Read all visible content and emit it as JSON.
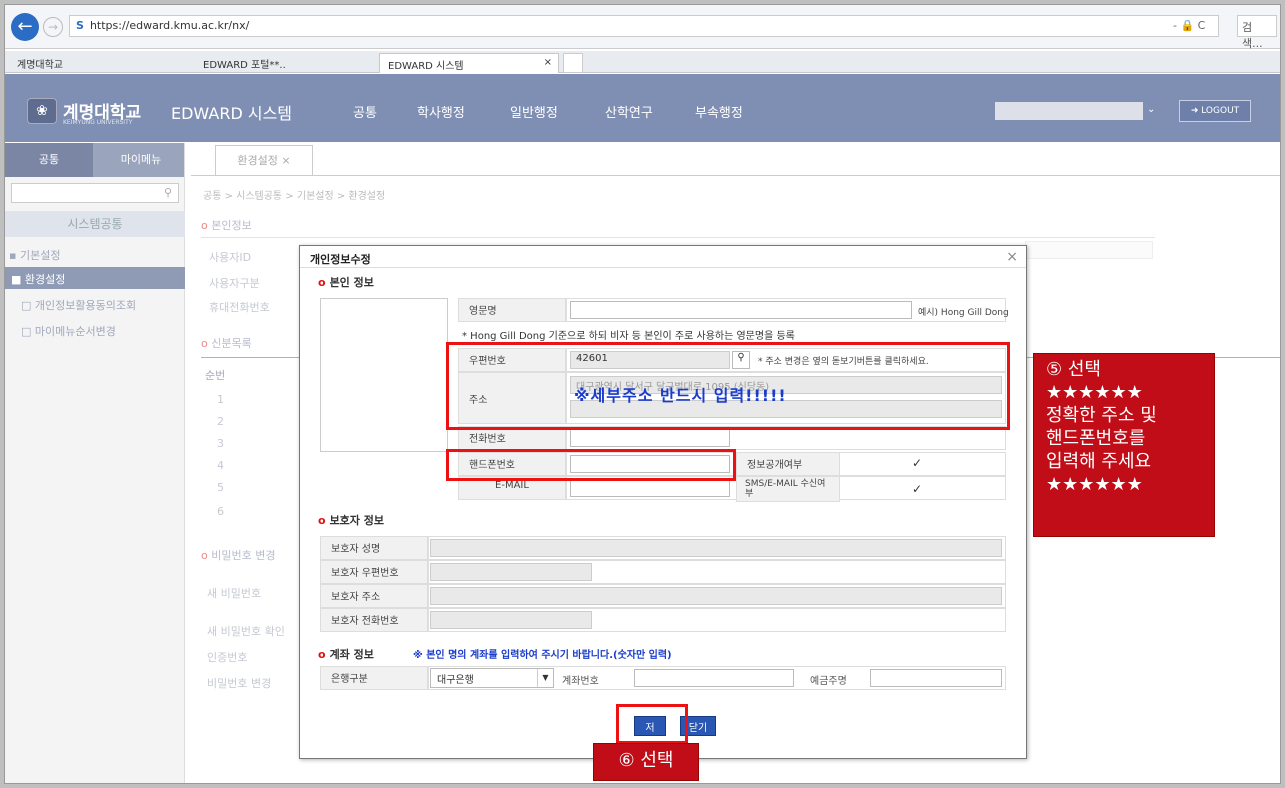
{
  "browser": {
    "url": "https://edward.kmu.ac.kr/nx/",
    "addr_right": "- 🔒 C",
    "search_placeholder": "검색...",
    "tabs": [
      "계명대학교",
      "EDWARD 포털**..",
      "EDWARD 시스템"
    ],
    "tab_close": "×"
  },
  "nav": {
    "logo_text": "계명대학교",
    "logo_sub": "KEIMYUNG UNIVERSITY",
    "system_title": "EDWARD 시스템",
    "menus": [
      "공통",
      "학사행정",
      "일반행정",
      "산학연구",
      "부속행정"
    ],
    "logout": "LOGOUT"
  },
  "sidebar": {
    "tabs": [
      "공통",
      "마이메뉴"
    ],
    "header": "시스템공통",
    "items": [
      "기본설정",
      "환경설정",
      "개인정보활용동의조회",
      "마이메뉴순서변경"
    ]
  },
  "content": {
    "tab": "환경설정",
    "breadcrumb": "공통 > 시스템공통 > 기본설정 > 환경설정",
    "bg_sections": [
      "본인정보",
      "신분목록",
      "비밀번호 변경"
    ],
    "bg_labels": [
      "사용자ID",
      "사용자구분",
      "휴대전화번호"
    ],
    "bg_col": "순번",
    "bg_rows": [
      "1",
      "2",
      "3",
      "4",
      "5",
      "6"
    ],
    "bg_pw_labels": [
      "새 비밀번호",
      "새 비밀번호 확인",
      "인증번호",
      "비밀번호 변경"
    ]
  },
  "dialog": {
    "title": "개인정보수정",
    "close": "×",
    "personal_section": "본인 정보",
    "labels": {
      "eng_name": "영문명",
      "zip": "우편번호",
      "address": "주소",
      "phone": "전화번호",
      "mobile": "핸드폰번호",
      "email": "E-MAIL",
      "info_public": "정보공개여부",
      "sms_email": "SMS/E-MAIL 수신여부"
    },
    "eng_hint": "예시) Hong Gill Dong",
    "eng_note": "* Hong Gill Dong 기준으로 하되 비자 등 본인이 주로 사용하는 영문명을 등록",
    "zip_value": "42601",
    "zip_hint": "* 주소 변경은 옆의 돋보기버튼를 클릭하세요.",
    "address_value": "대구광역시 달서구 달구벌대로 1095 (신당동)",
    "alert": "※세부주소 반드시 입력!!!!!",
    "checkmark": "✓",
    "guardian_section": "보호자 정보",
    "guardian_labels": [
      "보호자 성명",
      "보호자 우편번호",
      "보호자 주소",
      "보호자 전화번호"
    ],
    "account_section": "계좌 정보",
    "account_warning": "※ 본인 명의 계좌를 입력하여 주시기 바랍니다.(숫자만 입력)",
    "bank_label": "은행구분",
    "bank_value": "대구은행",
    "account_no_label": "계좌번호",
    "holder_label": "예금주명",
    "save": "저장",
    "cancel": "닫기"
  },
  "callouts": {
    "step5": "⑤ 선택",
    "stars": "★★★★★★",
    "line1": "정확한 주소 및",
    "line2": "핸드폰번호를",
    "line3": "입력해 주세요",
    "step6": "⑥ 선택"
  },
  "colors": {
    "nav_bg": "#7f8fb4",
    "callout_red": "#c00d17",
    "highlight_red": "#e11111",
    "alert_blue": "#1a3ccc",
    "button_blue": "#2a56b4"
  }
}
